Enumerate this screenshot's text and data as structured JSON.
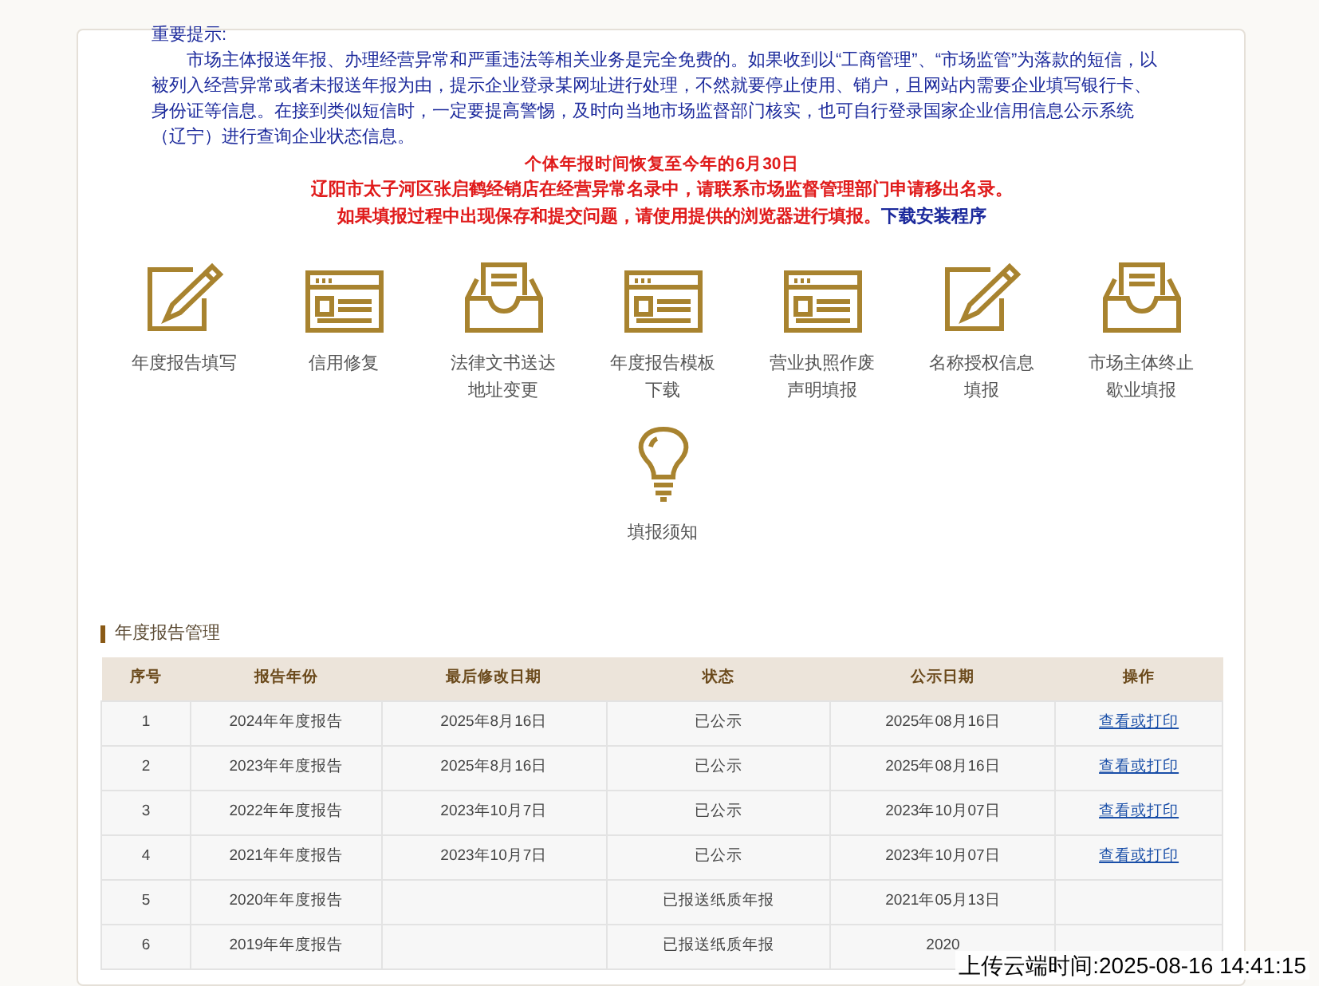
{
  "notice": {
    "title": "重要提示:",
    "body": "市场主体报送年报、办理经营异常和严重违法等相关业务是完全免费的。如果收到以“工商管理”、“市场监管”为落款的短信，以被列入经营异常或者未报送年报为由，提示企业登录某网址进行处理，不然就要停止使用、销户，且网站内需要企业填写银行卡、身份证等信息。在接到类似短信时，一定要提高警惕，及时向当地市场监督部门核实，也可自行登录国家企业信用信息公示系统（辽宁）进行查询企业状态信息。"
  },
  "alerts": [
    "个体年报时间恢复至今年的6月30日",
    "辽阳市太子河区张启鹤经销店在经营异常名录中，请联系市场监督管理部门申请移出名录。"
  ],
  "browser_notice": {
    "text": "如果填报过程中出现保存和提交问题，请使用提供的浏览器进行填报。",
    "link": "下载安装程序"
  },
  "services": [
    {
      "kind": "edit",
      "label": "年度报告填写"
    },
    {
      "kind": "browser",
      "label": "信用修复"
    },
    {
      "kind": "inbox",
      "label": "法律文书送达地址变更"
    },
    {
      "kind": "browser",
      "label": "年度报告模板下载"
    },
    {
      "kind": "browser",
      "label": "营业执照作废声明填报"
    },
    {
      "kind": "edit",
      "label": "名称授权信息填报"
    },
    {
      "kind": "inbox",
      "label": "市场主体终止歇业填报"
    },
    {
      "kind": "bulb",
      "label": "填报须知"
    }
  ],
  "section_title": "年度报告管理",
  "table": {
    "columns": [
      "序号",
      "报告年份",
      "最后修改日期",
      "状态",
      "公示日期",
      "操作"
    ],
    "rows": [
      [
        "1",
        "2024年年度报告",
        "2025年8月16日",
        "已公示",
        "2025年08月16日",
        "查看或打印"
      ],
      [
        "2",
        "2023年年度报告",
        "2025年8月16日",
        "已公示",
        "2025年08月16日",
        "查看或打印"
      ],
      [
        "3",
        "2022年年度报告",
        "2023年10月7日",
        "已公示",
        "2023年10月07日",
        "查看或打印"
      ],
      [
        "4",
        "2021年年度报告",
        "2023年10月7日",
        "已公示",
        "2023年10月07日",
        "查看或打印"
      ],
      [
        "5",
        "2020年年度报告",
        "",
        "已报送纸质年报",
        "2021年05月13日",
        ""
      ],
      [
        "6",
        "2019年年度报告",
        "",
        "已报送纸质年报",
        "2020",
        ""
      ]
    ]
  },
  "upload_stamp": "上传云端时间:2025-08-16 14:41:15"
}
